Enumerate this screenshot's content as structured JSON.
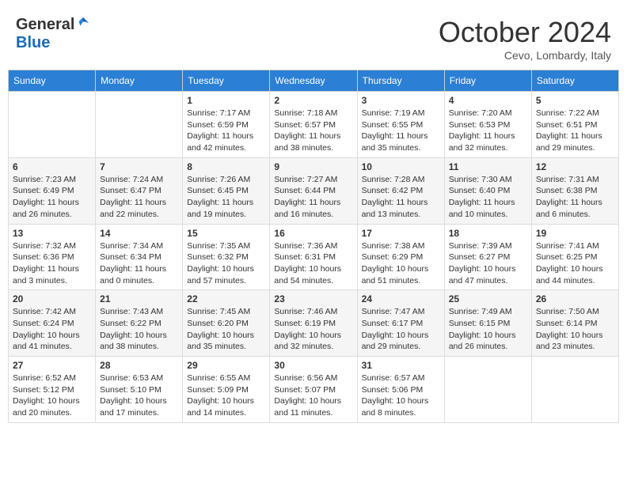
{
  "header": {
    "logo_general": "General",
    "logo_blue": "Blue",
    "month_title": "October 2024",
    "location": "Cevo, Lombardy, Italy"
  },
  "days_of_week": [
    "Sunday",
    "Monday",
    "Tuesday",
    "Wednesday",
    "Thursday",
    "Friday",
    "Saturday"
  ],
  "weeks": [
    [
      {
        "day": "",
        "info": ""
      },
      {
        "day": "",
        "info": ""
      },
      {
        "day": "1",
        "info": "Sunrise: 7:17 AM\nSunset: 6:59 PM\nDaylight: 11 hours and 42 minutes."
      },
      {
        "day": "2",
        "info": "Sunrise: 7:18 AM\nSunset: 6:57 PM\nDaylight: 11 hours and 38 minutes."
      },
      {
        "day": "3",
        "info": "Sunrise: 7:19 AM\nSunset: 6:55 PM\nDaylight: 11 hours and 35 minutes."
      },
      {
        "day": "4",
        "info": "Sunrise: 7:20 AM\nSunset: 6:53 PM\nDaylight: 11 hours and 32 minutes."
      },
      {
        "day": "5",
        "info": "Sunrise: 7:22 AM\nSunset: 6:51 PM\nDaylight: 11 hours and 29 minutes."
      }
    ],
    [
      {
        "day": "6",
        "info": "Sunrise: 7:23 AM\nSunset: 6:49 PM\nDaylight: 11 hours and 26 minutes."
      },
      {
        "day": "7",
        "info": "Sunrise: 7:24 AM\nSunset: 6:47 PM\nDaylight: 11 hours and 22 minutes."
      },
      {
        "day": "8",
        "info": "Sunrise: 7:26 AM\nSunset: 6:45 PM\nDaylight: 11 hours and 19 minutes."
      },
      {
        "day": "9",
        "info": "Sunrise: 7:27 AM\nSunset: 6:44 PM\nDaylight: 11 hours and 16 minutes."
      },
      {
        "day": "10",
        "info": "Sunrise: 7:28 AM\nSunset: 6:42 PM\nDaylight: 11 hours and 13 minutes."
      },
      {
        "day": "11",
        "info": "Sunrise: 7:30 AM\nSunset: 6:40 PM\nDaylight: 11 hours and 10 minutes."
      },
      {
        "day": "12",
        "info": "Sunrise: 7:31 AM\nSunset: 6:38 PM\nDaylight: 11 hours and 6 minutes."
      }
    ],
    [
      {
        "day": "13",
        "info": "Sunrise: 7:32 AM\nSunset: 6:36 PM\nDaylight: 11 hours and 3 minutes."
      },
      {
        "day": "14",
        "info": "Sunrise: 7:34 AM\nSunset: 6:34 PM\nDaylight: 11 hours and 0 minutes."
      },
      {
        "day": "15",
        "info": "Sunrise: 7:35 AM\nSunset: 6:32 PM\nDaylight: 10 hours and 57 minutes."
      },
      {
        "day": "16",
        "info": "Sunrise: 7:36 AM\nSunset: 6:31 PM\nDaylight: 10 hours and 54 minutes."
      },
      {
        "day": "17",
        "info": "Sunrise: 7:38 AM\nSunset: 6:29 PM\nDaylight: 10 hours and 51 minutes."
      },
      {
        "day": "18",
        "info": "Sunrise: 7:39 AM\nSunset: 6:27 PM\nDaylight: 10 hours and 47 minutes."
      },
      {
        "day": "19",
        "info": "Sunrise: 7:41 AM\nSunset: 6:25 PM\nDaylight: 10 hours and 44 minutes."
      }
    ],
    [
      {
        "day": "20",
        "info": "Sunrise: 7:42 AM\nSunset: 6:24 PM\nDaylight: 10 hours and 41 minutes."
      },
      {
        "day": "21",
        "info": "Sunrise: 7:43 AM\nSunset: 6:22 PM\nDaylight: 10 hours and 38 minutes."
      },
      {
        "day": "22",
        "info": "Sunrise: 7:45 AM\nSunset: 6:20 PM\nDaylight: 10 hours and 35 minutes."
      },
      {
        "day": "23",
        "info": "Sunrise: 7:46 AM\nSunset: 6:19 PM\nDaylight: 10 hours and 32 minutes."
      },
      {
        "day": "24",
        "info": "Sunrise: 7:47 AM\nSunset: 6:17 PM\nDaylight: 10 hours and 29 minutes."
      },
      {
        "day": "25",
        "info": "Sunrise: 7:49 AM\nSunset: 6:15 PM\nDaylight: 10 hours and 26 minutes."
      },
      {
        "day": "26",
        "info": "Sunrise: 7:50 AM\nSunset: 6:14 PM\nDaylight: 10 hours and 23 minutes."
      }
    ],
    [
      {
        "day": "27",
        "info": "Sunrise: 6:52 AM\nSunset: 5:12 PM\nDaylight: 10 hours and 20 minutes."
      },
      {
        "day": "28",
        "info": "Sunrise: 6:53 AM\nSunset: 5:10 PM\nDaylight: 10 hours and 17 minutes."
      },
      {
        "day": "29",
        "info": "Sunrise: 6:55 AM\nSunset: 5:09 PM\nDaylight: 10 hours and 14 minutes."
      },
      {
        "day": "30",
        "info": "Sunrise: 6:56 AM\nSunset: 5:07 PM\nDaylight: 10 hours and 11 minutes."
      },
      {
        "day": "31",
        "info": "Sunrise: 6:57 AM\nSunset: 5:06 PM\nDaylight: 10 hours and 8 minutes."
      },
      {
        "day": "",
        "info": ""
      },
      {
        "day": "",
        "info": ""
      }
    ]
  ]
}
